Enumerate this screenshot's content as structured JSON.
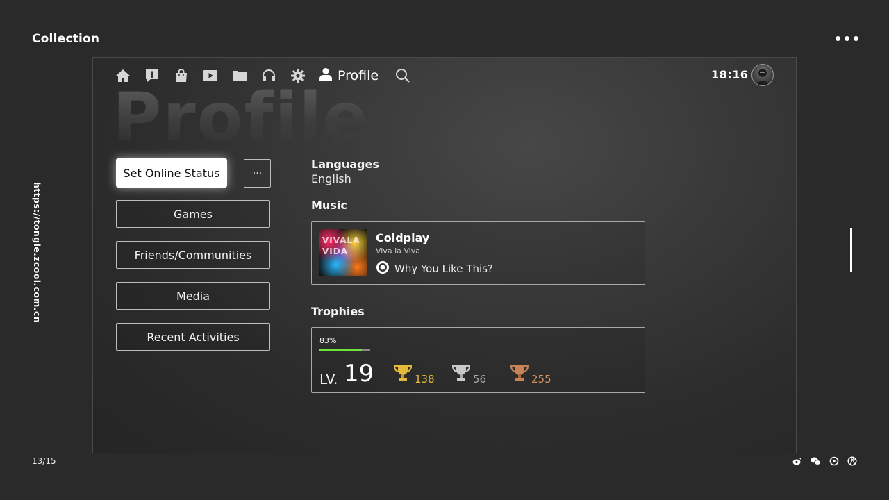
{
  "page": {
    "title": "Collection",
    "url_vertical": "https://tongle.zcool.com.cn",
    "page_count": "13/15"
  },
  "nav": {
    "items": [
      {
        "name": "home-icon"
      },
      {
        "name": "notifications-icon"
      },
      {
        "name": "store-icon"
      },
      {
        "name": "media-icon"
      },
      {
        "name": "folder-icon"
      },
      {
        "name": "headset-icon"
      },
      {
        "name": "settings-icon"
      }
    ],
    "active_label": "Profile",
    "active_icon": "person-icon",
    "search_icon": "search-icon",
    "time": "18:16"
  },
  "hero": {
    "watermark": "Profile"
  },
  "actions": {
    "primary": "Set Online Status",
    "more": "···",
    "menu": [
      "Games",
      "Friends/Communities",
      "Media",
      "Recent Activities"
    ]
  },
  "languages": {
    "heading": "Languages",
    "value": "English"
  },
  "music": {
    "heading": "Music",
    "artist": "Coldplay",
    "album": "Viva la Viva",
    "reason": "Why You Like This?",
    "cover_text": "VIVALAVIDA"
  },
  "trophies": {
    "heading": "Trophies",
    "progress_label": "83%",
    "progress": 0.83,
    "level_prefix": "LV.",
    "level": "19",
    "gold": "138",
    "silver": "56",
    "bronze": "255",
    "colors": {
      "gold": "#e6b93a",
      "silver": "#c9c9c9",
      "bronze": "#c98355",
      "progress": "#6ee33c"
    }
  }
}
